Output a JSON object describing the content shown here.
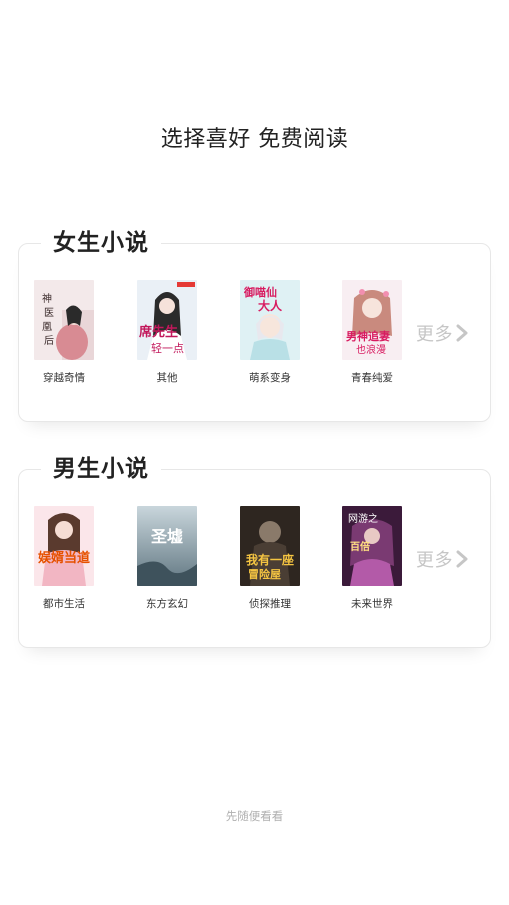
{
  "headline": "选择喜好 免费阅读",
  "female_section": {
    "title": "女生小说",
    "books": [
      {
        "label": "穿越奇情"
      },
      {
        "label": "其他"
      },
      {
        "label": "萌系变身"
      },
      {
        "label": "青春纯爱"
      }
    ],
    "more_label": "更多"
  },
  "male_section": {
    "title": "男生小说",
    "books": [
      {
        "label": "都市生活"
      },
      {
        "label": "东方玄幻"
      },
      {
        "label": "侦探推理"
      },
      {
        "label": "未来世界"
      }
    ],
    "more_label": "更多"
  },
  "skip_label": "先随便看看",
  "colors": {
    "title_text": "#222222",
    "more_text": "#c6c6c6",
    "card_border": "#e7e7e7",
    "skip_text": "#b0b0b0"
  }
}
